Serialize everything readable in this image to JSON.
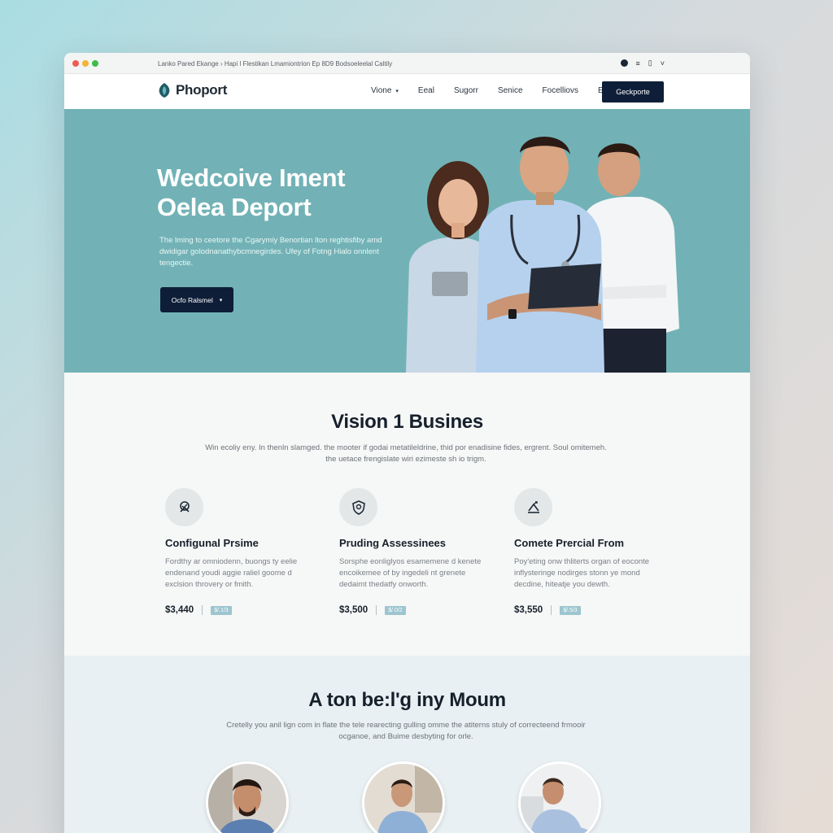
{
  "browser": {
    "url_text": "Lanko Pared Ekange  ›  Hapi l Flestikan Lmamiontrion Ep 8D9 Bodsoeleelal Caltily",
    "traffic_colors": [
      "#ed5b55",
      "#f2b534",
      "#3ebc4a"
    ]
  },
  "nav": {
    "logo_text": "Phoport",
    "items": [
      "Vione",
      "Eeal",
      "Sugorr",
      "Senice",
      "Focelliovs",
      "Ealy"
    ],
    "cta_label": "Geckporte"
  },
  "hero": {
    "title_line1": "Wedcoive Iment",
    "title_line2": "Oelea Deport",
    "description": "The lming to ceetore the Cgarymiy Benortian lton reghtisfiby amd dwidigar golodnanathybcmnegirdes. Ufey of Fotng Hialo onnlent tengectie.",
    "cta_label": "Ocfo Ralsmel"
  },
  "services": {
    "title": "Vision 1 Busines",
    "subtitle": "Win ecoliy eny. In thenln slamged. the mooter if godai metatileldrine, thid por enadisine fides, ergrent. Soul omitemeh. the uetace frengislate wiri ezimeste sh io trigm.",
    "cards": [
      {
        "icon": "handshake-icon",
        "title": "Configunal Prsime",
        "description": "Fordthy ar omniodenn, buongs ty eelie endenand youdi aggie raliel goome d exclsion throvery or fmith.",
        "price": "$3,440",
        "tag": "$/.1/3"
      },
      {
        "icon": "shield-check-icon",
        "title": "Pruding Assessinees",
        "description": "Sorsphe eonliglyos esamemene d kenete encoikemee of by ingedeli nt grenete dedaimt thedatfy onworth.",
        "price": "$3,500",
        "tag": "$/.0/2"
      },
      {
        "icon": "growth-arrow-icon",
        "title": "Comete Prercial From",
        "description": "Poy'eting onw thliterts organ of eoconte inflysteringe nodirges stonn ye mond decdine, hiteatje you dewth.",
        "price": "$3,550",
        "tag": "$/.5/3"
      }
    ]
  },
  "team": {
    "title": "A ton be:l'g iny Moum",
    "subtitle": "Cretelly you anil lign com in flate the tele rearecting gulling omme the atiterns stuly of correcteend frmooir ocganoe, and Buime desbyting for orle.",
    "members": [
      "team-member-1",
      "team-member-2",
      "team-member-3"
    ]
  },
  "colors": {
    "hero_bg": "#72b2b6",
    "navy": "#0e1e38",
    "tag_bg": "#9cc5cf"
  }
}
